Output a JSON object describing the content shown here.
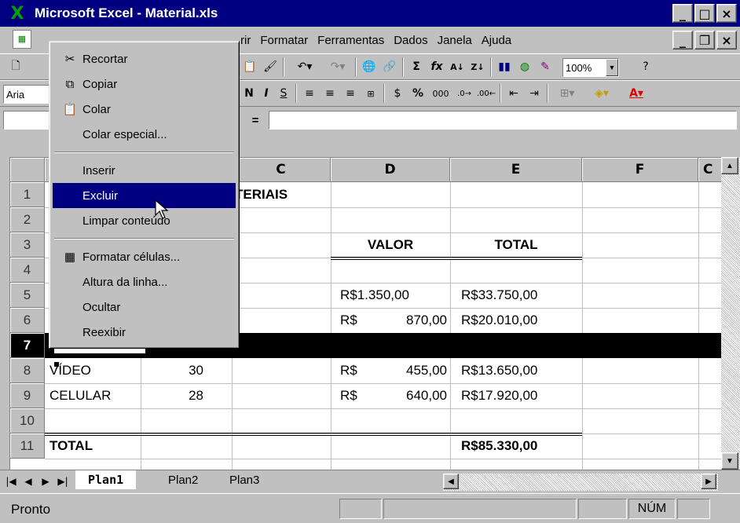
{
  "window": {
    "title": "Microsoft Excel - Material.xls",
    "min": "_",
    "max": "□",
    "close": "×"
  },
  "menubar": {
    "items": [
      "rir",
      "Formatar",
      "Ferramentas",
      "Dados",
      "Janela",
      "Ajuda"
    ]
  },
  "toolbar": {
    "zoom": "100%",
    "font": "Aria"
  },
  "formula": {
    "eq": "="
  },
  "columns": [
    "C",
    "D",
    "E",
    "F",
    "C"
  ],
  "rows": [
    "1",
    "2",
    "3",
    "4",
    "5",
    "6",
    "7",
    "8",
    "9",
    "10",
    "11"
  ],
  "cells": {
    "c1": "TERIAIS",
    "d3": "VALOR",
    "e3": "TOTAL",
    "d5": "R$1.350,00",
    "e5": "R$33.750,00",
    "d6a": "R$",
    "d6b": "870,00",
    "e6": "R$20.010,00",
    "a8": "VÍDEO",
    "b8": "30",
    "d8a": "R$",
    "d8b": "455,00",
    "e8": "R$13.650,00",
    "a9": "CELULAR",
    "b9": "28",
    "d9a": "R$",
    "d9b": "640,00",
    "e9": "R$17.920,00",
    "a11": "TOTAL",
    "e11": "R$85.330,00"
  },
  "context_menu": {
    "recortar": "Recortar",
    "copiar": "Copiar",
    "colar": "Colar",
    "colar_especial": "Colar especial...",
    "inserir": "Inserir",
    "excluir": "Excluir",
    "limpar": "Limpar conteúdo",
    "formatar": "Formatar células...",
    "altura": "Altura da linha...",
    "ocultar": "Ocultar",
    "reexibir": "Reexibir"
  },
  "sheets": [
    "Plan1",
    "Plan2",
    "Plan3"
  ],
  "status": {
    "text": "Pronto",
    "num": "NÚM"
  }
}
